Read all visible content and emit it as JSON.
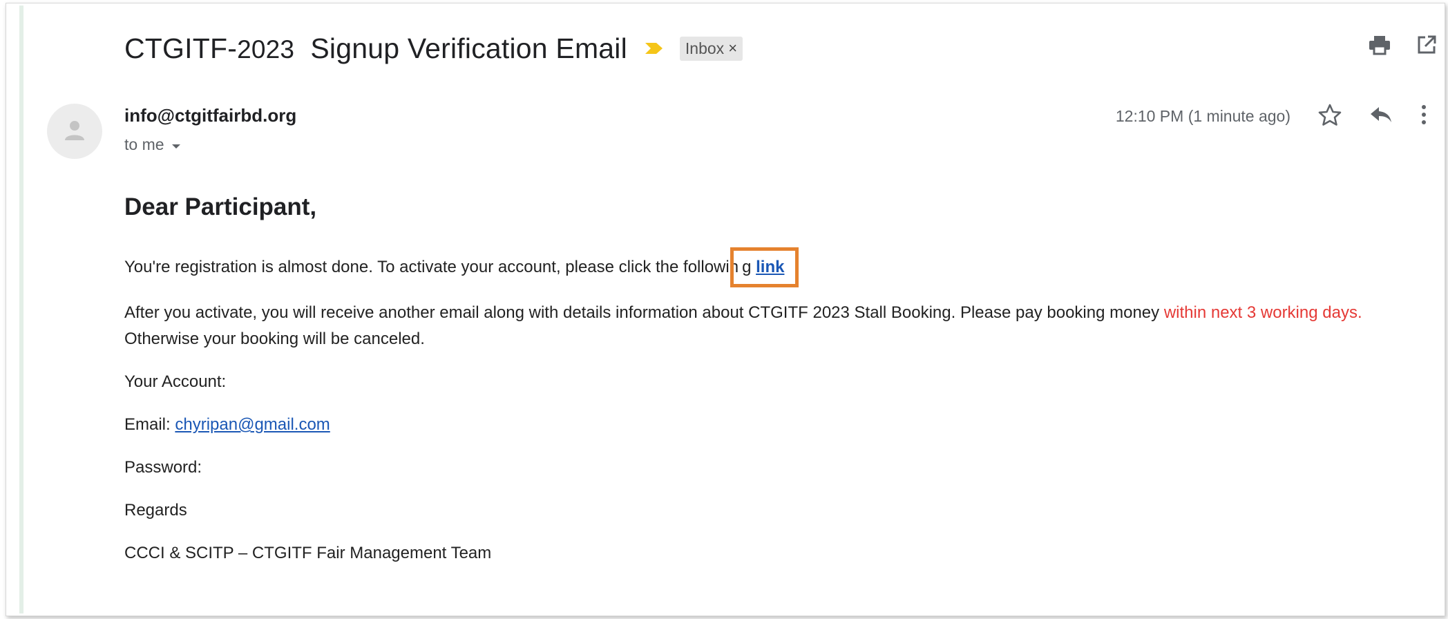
{
  "email": {
    "subject_prefix": "CTGITF-",
    "subject_year": "2023",
    "subject_rest": "Signup Verification Email",
    "label_chip": "Inbox",
    "label_chip_close": "×",
    "sender": "info@ctgitfairbd.org",
    "recipient": "to me",
    "time": "12:10 PM (1 minute ago)"
  },
  "body": {
    "greeting": "Dear Participant,",
    "line1_text": "You're registration is almost done. To activate your account, please click the followin",
    "line1_g": "g",
    "link_label": "link",
    "line2_a": "After you activate, you will receive another email along with details information about CTGITF",
    "line2_year": "2023",
    "line2_b": "Stall Booking. Please pay booking money",
    "line2_red": "within next 3 working days.",
    "line2_c": "Otherwise your booking will be canceled.",
    "account_heading": "Your Account:",
    "email_label": "Email:",
    "email_value": "chyripan@gmail.com",
    "password_label": "Password:",
    "regards": "Regards",
    "signature": "CCCI & SCITP – CTGITF Fair Management Team"
  },
  "colors": {
    "accent_red": "#e53935",
    "link_blue": "#1a57b5",
    "highlight_orange": "#e5822e",
    "important_yellow": "#f5c518"
  },
  "icons": [
    "important-marker-icon",
    "print-icon",
    "open-in-new-window-icon",
    "avatar-person-icon",
    "dropdown-arrow-icon",
    "star-icon",
    "reply-icon",
    "more-vert-icon"
  ]
}
